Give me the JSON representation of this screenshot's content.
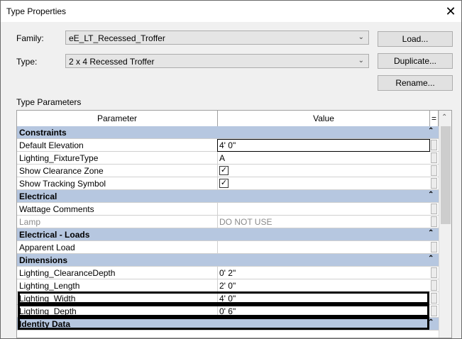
{
  "window": {
    "title": "Type Properties"
  },
  "family": {
    "label": "Family:",
    "value": "eE_LT_Recessed_Troffer"
  },
  "type": {
    "label": "Type:",
    "value": "2 x 4 Recessed Troffer"
  },
  "buttons": {
    "load": "Load...",
    "duplicate": "Duplicate...",
    "rename": "Rename..."
  },
  "section_label": "Type Parameters",
  "grid": {
    "col_parameter": "Parameter",
    "col_value": "Value",
    "col_menu": "=",
    "rows": [
      {
        "kind": "group",
        "param": "Constraints"
      },
      {
        "kind": "param",
        "param": "Default Elevation",
        "value": "4'  0\""
      },
      {
        "kind": "param",
        "param": "Lighting_FixtureType",
        "value": "A"
      },
      {
        "kind": "param",
        "param": "Show Clearance Zone",
        "value": "✓"
      },
      {
        "kind": "param",
        "param": "Show Tracking Symbol",
        "value": "✓"
      },
      {
        "kind": "group",
        "param": "Electrical"
      },
      {
        "kind": "param",
        "param": "Wattage Comments",
        "value": ""
      },
      {
        "kind": "param",
        "param": "Lamp",
        "value": "DO NOT USE"
      },
      {
        "kind": "group",
        "param": "Electrical - Loads"
      },
      {
        "kind": "param",
        "param": "Apparent Load",
        "value": ""
      },
      {
        "kind": "group",
        "param": "Dimensions"
      },
      {
        "kind": "param",
        "param": "Lighting_ClearanceDepth",
        "value": "0'  2\""
      },
      {
        "kind": "param",
        "param": "Lighting_Length",
        "value": "2'  0\""
      },
      {
        "kind": "param",
        "param": "Lighting_Width",
        "value": "4'  0\""
      },
      {
        "kind": "param",
        "param": "Lighting_Depth",
        "value": "0'  6\""
      },
      {
        "kind": "group",
        "param": "Identity Data"
      }
    ]
  },
  "icons": {
    "close": "close-icon",
    "dropdown": "chevron-down-icon",
    "collapse": "double-chevron-up-icon",
    "scroll_up": "scroll-up-icon",
    "checkbox": "checkbox-icon"
  },
  "colors": {
    "group_header": "#b6c7e0",
    "highlight_border": "#000000",
    "disabled_text": "#8a8a8a"
  }
}
